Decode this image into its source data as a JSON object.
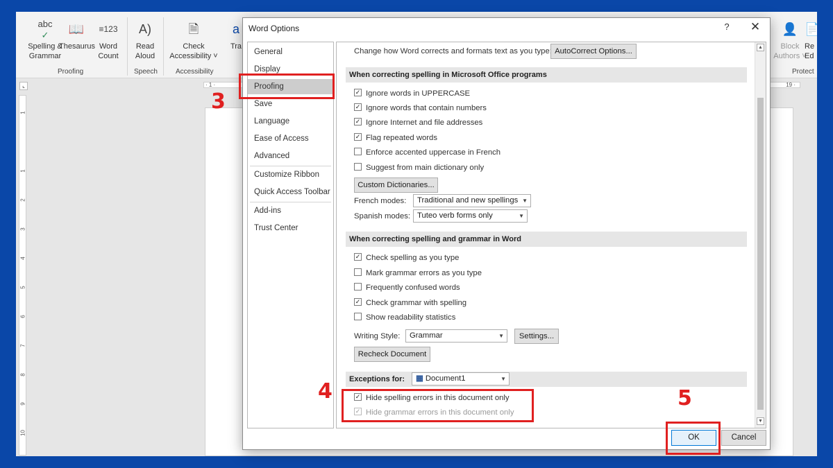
{
  "ribbon": {
    "buttons": [
      {
        "label": "Spelling &\nGrammar",
        "icon": "abc-check-icon"
      },
      {
        "label": "Thesaurus",
        "icon": "book-icon"
      },
      {
        "label": "Word\nCount",
        "icon": "word-count-icon"
      },
      {
        "label": "Read\nAloud",
        "icon": "read-aloud-icon"
      },
      {
        "label": "Check\nAccessibility ˅",
        "icon": "accessibility-icon"
      },
      {
        "label": "Tra",
        "icon": "translate-icon"
      },
      {
        "label": "Block\nAuthors ˅",
        "icon": "block-authors-icon"
      },
      {
        "label": "Re\nEd",
        "icon": "restrict-editing-icon"
      }
    ],
    "groups": [
      "Proofing",
      "Speech",
      "Accessibility",
      "Protect"
    ]
  },
  "ruler": {
    "left_mark": "· 1 ·",
    "right_mark": "19 ·",
    "vertical_marks": [
      "1",
      "1",
      "2",
      "3",
      "4",
      "5",
      "6",
      "7",
      "8",
      "9",
      "10"
    ]
  },
  "dialog": {
    "title": "Word Options",
    "help": "?",
    "close": "✕",
    "nav": [
      "General",
      "Display",
      "Proofing",
      "Save",
      "Language",
      "Ease of Access",
      "Advanced",
      "Customize Ribbon",
      "Quick Access Toolbar",
      "Add-ins",
      "Trust Center"
    ],
    "selected_nav": "Proofing",
    "autocorrect_text": "Change how Word corrects and formats text as you type:",
    "autocorrect_button": "AutoCorrect Options...",
    "section1_title": "When correcting spelling in Microsoft Office programs",
    "section1_options": [
      {
        "label": "Ignore words in UPPERCASE",
        "checked": true
      },
      {
        "label": "Ignore words that contain numbers",
        "checked": true
      },
      {
        "label": "Ignore Internet and file addresses",
        "checked": true
      },
      {
        "label": "Flag repeated words",
        "checked": true
      },
      {
        "label": "Enforce accented uppercase in French",
        "checked": false
      },
      {
        "label": "Suggest from main dictionary only",
        "checked": false
      }
    ],
    "custom_dict_button": "Custom Dictionaries...",
    "french_modes_label": "French modes:",
    "french_modes_value": "Traditional and new spellings",
    "spanish_modes_label": "Spanish modes:",
    "spanish_modes_value": "Tuteo verb forms only",
    "section2_title": "When correcting spelling and grammar in Word",
    "section2_options": [
      {
        "label": "Check spelling as you type",
        "checked": true
      },
      {
        "label": "Mark grammar errors as you type",
        "checked": false
      },
      {
        "label": "Frequently confused words",
        "checked": false
      },
      {
        "label": "Check grammar with spelling",
        "checked": true
      },
      {
        "label": "Show readability statistics",
        "checked": false
      }
    ],
    "writing_style_label": "Writing Style:",
    "writing_style_value": "Grammar",
    "settings_button": "Settings...",
    "recheck_button": "Recheck Document",
    "exceptions_label": "Exceptions for:",
    "exceptions_value": "Document1",
    "exception_options": [
      {
        "label": "Hide spelling errors in this document only",
        "checked": true,
        "disabled": false
      },
      {
        "label": "Hide grammar errors in this document only",
        "checked": true,
        "disabled": true
      }
    ],
    "ok_button": "OK",
    "cancel_button": "Cancel"
  },
  "annotations": {
    "step3": "3",
    "step4": "4",
    "step5": "5",
    "color": "#e02020"
  }
}
